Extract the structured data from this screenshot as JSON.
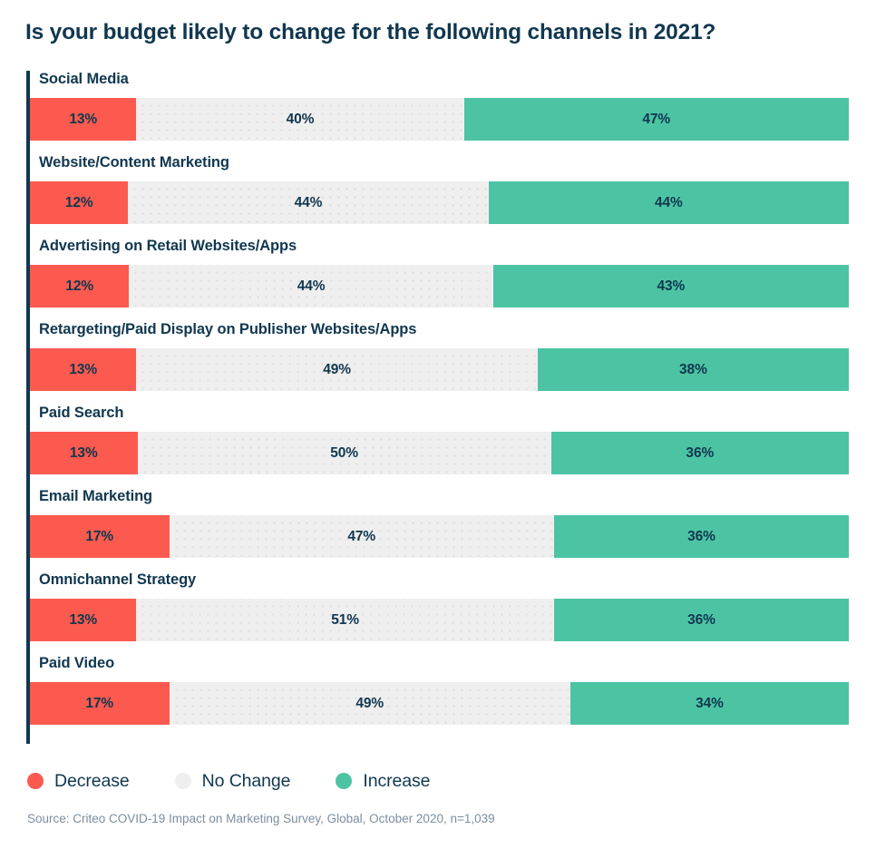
{
  "chart_data": {
    "type": "bar",
    "subtype": "stacked-horizontal-100",
    "title": "Is your budget likely to change for the following channels in 2021?",
    "xlabel": "",
    "ylabel": "",
    "xlim": [
      0,
      100
    ],
    "grid": false,
    "legend_position": "bottom-left",
    "value_suffix": "%",
    "categories": [
      "Social Media",
      "Website/Content Marketing",
      "Advertising on Retail Websites/Apps",
      "Retargeting/Paid Display on Publisher Websites/Apps",
      "Paid Search",
      "Email Marketing",
      "Omnichannel Strategy",
      "Paid Video"
    ],
    "series": [
      {
        "name": "Decrease",
        "color": "#fc5a4f",
        "values": [
          13,
          12,
          12,
          13,
          13,
          17,
          13,
          17
        ],
        "labels": [
          "13%",
          "12%",
          "12%",
          "13%",
          "13%",
          "17%",
          "13%",
          "17%"
        ]
      },
      {
        "name": "No Change",
        "color": "#efefef",
        "values": [
          40,
          44,
          44,
          49,
          50,
          47,
          51,
          49
        ],
        "labels": [
          "40%",
          "44%",
          "44%",
          "49%",
          "50%",
          "47%",
          "51%",
          "49%"
        ]
      },
      {
        "name": "Increase",
        "color": "#4cc4a4",
        "values": [
          47,
          44,
          43,
          38,
          36,
          36,
          36,
          34
        ],
        "labels": [
          "47%",
          "44%",
          "43%",
          "38%",
          "36%",
          "36%",
          "36%",
          "34%"
        ]
      }
    ],
    "source": "Source: Criteo COVID-19 Impact on Marketing Survey, Global, October 2020, n=1,039"
  },
  "legend": {
    "items": [
      {
        "label": "Decrease",
        "color": "#fc5a4f"
      },
      {
        "label": "No Change",
        "color": "#efefef"
      },
      {
        "label": "Increase",
        "color": "#4cc4a4"
      }
    ]
  },
  "theme": {
    "text_color": "#10374f",
    "source_color": "#7b8ea0",
    "background": "#ffffff",
    "axis_color": "#10374f"
  }
}
